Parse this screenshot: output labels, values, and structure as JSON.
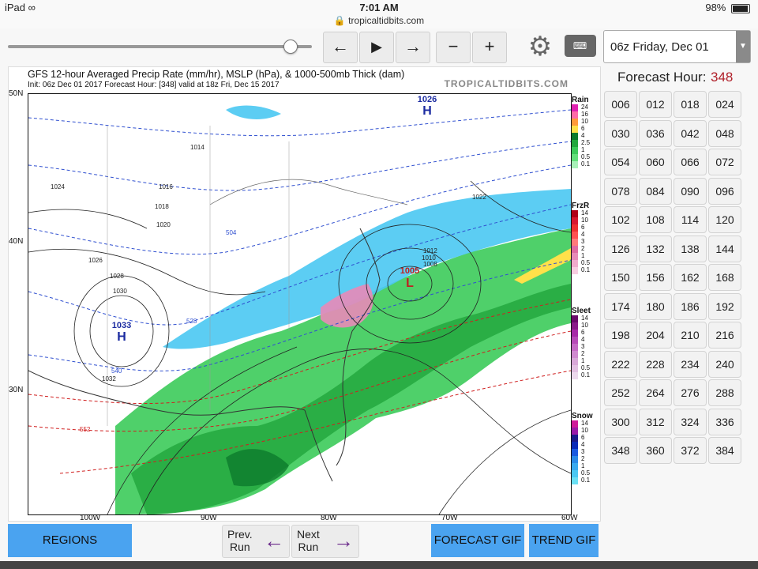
{
  "status_bar": {
    "device": "iPad",
    "time": "7:01 AM",
    "url": "tropicaltidbits.com",
    "battery": "98%"
  },
  "toolbar": {
    "prev_label": "←",
    "play_label": "▶",
    "next_label": "→",
    "minus_label": "−",
    "plus_label": "+",
    "gear_icon": "⚙",
    "keyboard_icon": "⌨",
    "run_select_value": "06z Friday, Dec 01",
    "run_select_arrow": "▼",
    "slider_position_fraction": 0.93
  },
  "map": {
    "title": "GFS 12-hour Averaged Precip Rate (mm/hr), MSLP (hPa), & 1000-500mb Thick (dam)",
    "subtitle": "Init: 06z Dec 01 2017   Forecast Hour: [348]   valid at 18z Fri, Dec 15 2017",
    "brand": "TROPICALTIDBITS.COM",
    "lat_labels": [
      "50N",
      "40N",
      "30N"
    ],
    "lon_labels": [
      "100W",
      "90W",
      "80W",
      "70W",
      "60W"
    ],
    "high_labels": [
      {
        "letter": "H",
        "value": "1033"
      },
      {
        "letter": "H",
        "value": "1026"
      }
    ],
    "low_labels": [
      {
        "letter": "L",
        "value": "1005"
      }
    ],
    "isobar_labels": [
      "1014",
      "1016",
      "1018",
      "1020",
      "1022",
      "1024",
      "1026",
      "1028",
      "1030",
      "1032",
      "1012",
      "1010",
      "1008"
    ],
    "thickness_labels": [
      "504",
      "528",
      "540",
      "552"
    ]
  },
  "legends": {
    "rain": {
      "title": "Rain",
      "labels": [
        "24",
        "16",
        "10",
        "6",
        "4",
        "2.5",
        "1",
        "0.5",
        "0.1"
      ],
      "colors": [
        "#e020b0",
        "#ff6aa8",
        "#ff9a3a",
        "#ffe14a",
        "#0d7a2c",
        "#23a83e",
        "#3ccb5a",
        "#62e07a",
        "#a8f0b8"
      ]
    },
    "frzr": {
      "title": "FrzR",
      "labels": [
        "14",
        "10",
        "6",
        "4",
        "3",
        "2",
        "1",
        "0.5",
        "0.1"
      ],
      "colors": [
        "#b00018",
        "#d81830",
        "#ee3030",
        "#ff5050",
        "#ff7a7a",
        "#e06aa0",
        "#e88ab8",
        "#f0aacc",
        "#f7cce0"
      ]
    },
    "sleet": {
      "title": "Sleet",
      "labels": [
        "14",
        "10",
        "6",
        "4",
        "3",
        "2",
        "1",
        "0.5",
        "0.1"
      ],
      "colors": [
        "#6a0a6a",
        "#8a1a8a",
        "#a82aa8",
        "#b84ab8",
        "#c66ac6",
        "#d08ad0",
        "#d8a8d8",
        "#e2c0e2",
        "#ecd8ec"
      ]
    },
    "snow": {
      "title": "Snow",
      "labels": [
        "14",
        "10",
        "6",
        "4",
        "3",
        "2",
        "1",
        "0.5",
        "0.1"
      ],
      "colors": [
        "#d01a9a",
        "#9a1aa8",
        "#1a1a8a",
        "#0a2ab8",
        "#1a5ae0",
        "#2a8ae8",
        "#3aaaf0",
        "#4ac8f2",
        "#6ae0f4"
      ]
    }
  },
  "forecast": {
    "title": "Forecast Hour:",
    "current": "348",
    "hours": [
      "006",
      "012",
      "018",
      "024",
      "030",
      "036",
      "042",
      "048",
      "054",
      "060",
      "066",
      "072",
      "078",
      "084",
      "090",
      "096",
      "102",
      "108",
      "114",
      "120",
      "126",
      "132",
      "138",
      "144",
      "150",
      "156",
      "162",
      "168",
      "174",
      "180",
      "186",
      "192",
      "198",
      "204",
      "210",
      "216",
      "222",
      "228",
      "234",
      "240",
      "252",
      "264",
      "276",
      "288",
      "300",
      "312",
      "324",
      "336",
      "348",
      "360",
      "372",
      "384"
    ]
  },
  "bottom": {
    "regions": "REGIONS",
    "prev_run": "Prev.\nRun",
    "prev_arrow": "←",
    "next_run": "Next\nRun",
    "next_arrow": "→",
    "forecast_gif": "FORECAST GIF",
    "trend_gif": "TREND GIF"
  }
}
